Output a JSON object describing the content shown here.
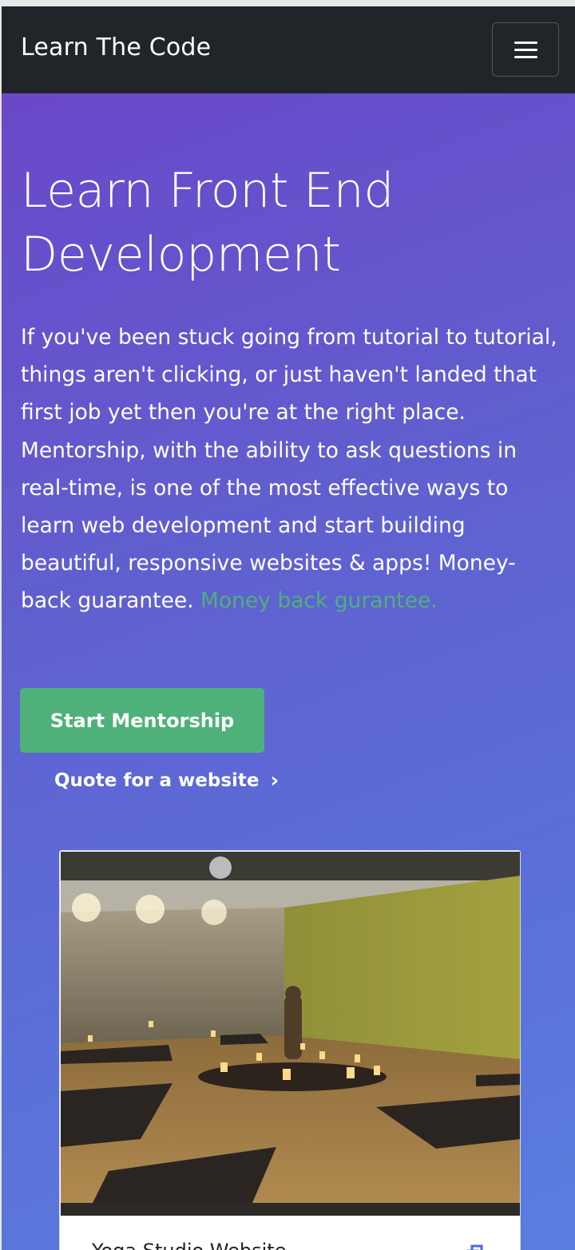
{
  "navbar": {
    "brand": "Learn The Code",
    "menu_icon": "hamburger-menu-icon"
  },
  "hero": {
    "title": "Learn Front End Development",
    "description": "If you've been stuck going from tutorial to tutorial, things aren't clicking, or just haven't landed that first job yet then you're at the right place. Mentorship, with the ability to ask questions in real-time, is one of the most effective ways to learn web development and start building beautiful, responsive websites & apps! Money-back guarantee.",
    "highlight": "Money back gurantee.",
    "primary_button": "Start Mentorship",
    "secondary_link": "Quote for a website",
    "secondary_icon": "chevron-right-icon"
  },
  "portfolio_card": {
    "title": "Yoga Studio Website",
    "image_alt": "Yoga studio website screenshot",
    "icon": "external-link-icon"
  },
  "colors": {
    "navbar_bg": "#212529",
    "accent_green": "#4fb17a",
    "hero_gradient_start": "#6a48c9",
    "hero_gradient_end": "#5a7de0"
  }
}
